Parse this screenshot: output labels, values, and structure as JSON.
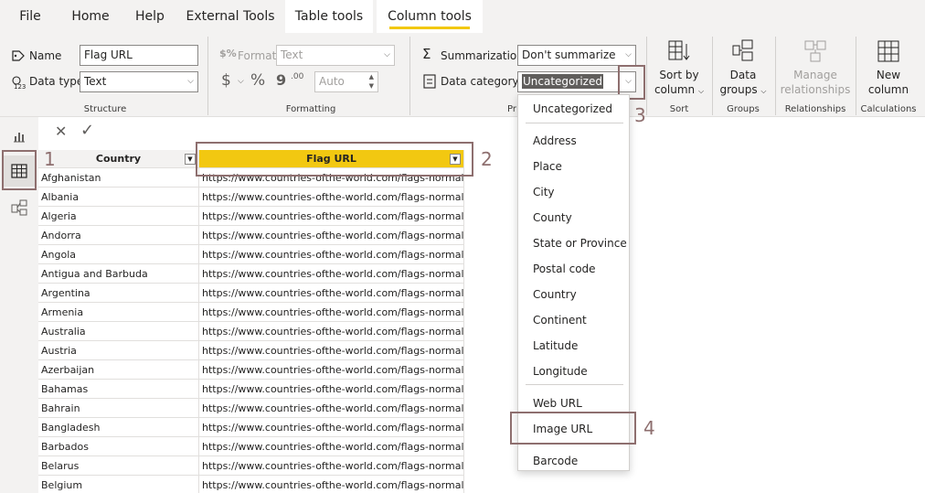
{
  "tabs": [
    {
      "label": "File"
    },
    {
      "label": "Home"
    },
    {
      "label": "Help"
    },
    {
      "label": "External Tools"
    },
    {
      "label": "Table tools"
    },
    {
      "label": "Column tools"
    }
  ],
  "structure": {
    "name_label": "Name",
    "name_value": "Flag URL",
    "datatype_label": "Data type",
    "datatype_value": "Text",
    "group_label": "Structure"
  },
  "formatting": {
    "format_label": "Format",
    "format_value": "Text",
    "currency": "$",
    "percent": "%",
    "comma": "9",
    "decimals_icon": ".00",
    "auto_value": "Auto",
    "group_label": "Formatting"
  },
  "properties": {
    "summarization_label": "Summarization",
    "summarization_value": "Don't summarize",
    "category_label": "Data category",
    "category_value": "Uncategorized",
    "group_label_partial": "Pr"
  },
  "sort": {
    "button_line1": "Sort by",
    "button_line2": "column",
    "group_label": "Sort"
  },
  "groups": {
    "button_line1": "Data",
    "button_line2": "groups",
    "group_label": "Groups"
  },
  "relationships": {
    "button_line1": "Manage",
    "button_line2": "relationships",
    "group_label": "Relationships"
  },
  "calculations": {
    "button_line1": "New",
    "button_line2": "column",
    "group_label": "Calculations"
  },
  "table": {
    "columns": [
      "Country",
      "Flag URL"
    ],
    "url_text": "https://www.countries-ofthe-world.com/flags-normal/flag",
    "rows": [
      "Afghanistan",
      "Albania",
      "Algeria",
      "Andorra",
      "Angola",
      "Antigua and Barbuda",
      "Argentina",
      "Armenia",
      "Australia",
      "Austria",
      "Azerbaijan",
      "Bahamas",
      "Bahrain",
      "Bangladesh",
      "Barbados",
      "Belarus",
      "Belgium"
    ]
  },
  "menu": {
    "items": [
      "Uncategorized",
      "Address",
      "Place",
      "City",
      "County",
      "State or Province",
      "Postal code",
      "Country",
      "Continent",
      "Latitude",
      "Longitude",
      "Web URL",
      "Image URL",
      "Barcode"
    ]
  },
  "annotations": [
    "1",
    "2",
    "3",
    "4"
  ],
  "colors": {
    "accent": "#f2c811",
    "annotation": "#8e6f6f",
    "ribbon": "#f3f2f1"
  }
}
